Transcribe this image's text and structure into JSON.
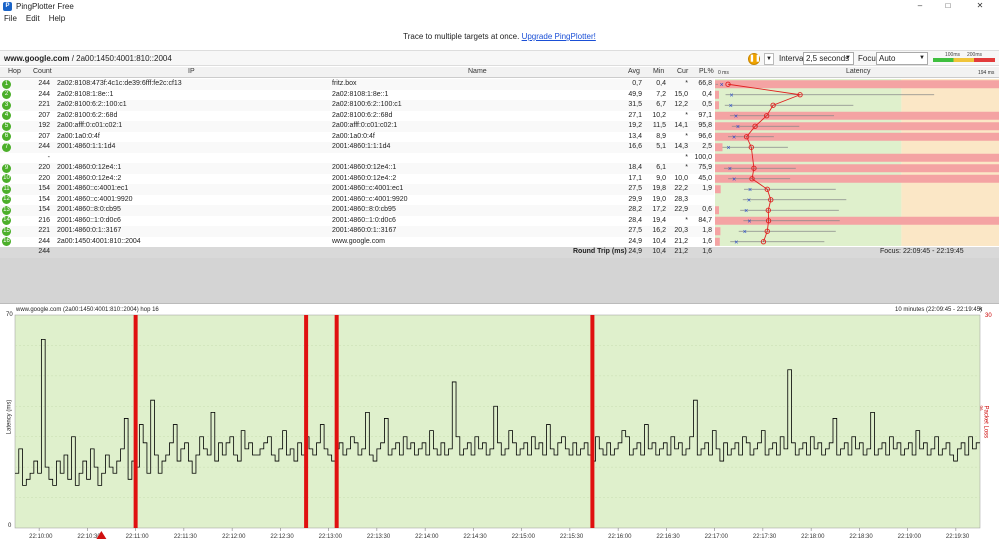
{
  "window": {
    "title": "PingPlotter Free",
    "controls": [
      "–",
      "□",
      "✕"
    ]
  },
  "menu": [
    "File",
    "Edit",
    "Help"
  ],
  "promo": {
    "text": "Trace to multiple targets at once. ",
    "link": "Upgrade PingPlotter!"
  },
  "toolbar": {
    "target_host": "www.google.com",
    "target_ip": " / 2a00:1450:4001:810::2004",
    "interval_label": "Interval",
    "interval_value": "2,5 seconds",
    "focus_label": "Focus",
    "focus_value": "Auto",
    "scale_100": "100ms",
    "scale_200": "200ms"
  },
  "table": {
    "headers": {
      "hop": "Hop",
      "count": "Count",
      "ip": "IP",
      "name": "Name",
      "avg": "Avg",
      "min": "Min",
      "cur": "Cur",
      "pl": "PL%",
      "latency": "Latency",
      "lat_min": "0 ms",
      "lat_max": "194 ms"
    },
    "rows": [
      {
        "hop": "1",
        "count": "244",
        "ip": "2a02:8108:473f:4c1c:de39:6fff:fe2c:cf13",
        "name": "fritz.box",
        "avg": "0,7",
        "min": "0,4",
        "cur": "*",
        "pl": "66,8"
      },
      {
        "hop": "2",
        "count": "244",
        "ip": "2a02:8108:1:8e::1",
        "name": "2a02:8108:1:8e::1",
        "avg": "49,9",
        "min": "7,2",
        "cur": "15,0",
        "pl": "0,4"
      },
      {
        "hop": "3",
        "count": "221",
        "ip": "2a02:8100:6:2::100:c1",
        "name": "2a02:8100:6:2::100:c1",
        "avg": "31,5",
        "min": "6,7",
        "cur": "12,2",
        "pl": "0,5"
      },
      {
        "hop": "4",
        "count": "207",
        "ip": "2a02:8100:6:2::68d",
        "name": "2a02:8100:6:2::68d",
        "avg": "27,1",
        "min": "10,2",
        "cur": "*",
        "pl": "97,1"
      },
      {
        "hop": "5",
        "count": "192",
        "ip": "2a00:afff:0:c01:c02:1",
        "name": "2a00:afff:0:c01:c02:1",
        "avg": "19,2",
        "min": "11,5",
        "cur": "14,1",
        "pl": "95,8"
      },
      {
        "hop": "6",
        "count": "207",
        "ip": "2a00:1a0:0:4f",
        "name": "2a00:1a0:0:4f",
        "avg": "13,4",
        "min": "8,9",
        "cur": "*",
        "pl": "96,6"
      },
      {
        "hop": "7",
        "count": "244",
        "ip": "2001:4860:1:1:1d4",
        "name": "2001:4860:1:1:1d4",
        "avg": "16,6",
        "min": "5,1",
        "cur": "14,3",
        "pl": "2,5"
      },
      {
        "hop": "",
        "count": "-",
        "ip": "",
        "name": "",
        "avg": "",
        "min": "",
        "cur": "*",
        "pl": "100,0"
      },
      {
        "hop": "9",
        "count": "220",
        "ip": "2001:4860:0:12e4::1",
        "name": "2001:4860:0:12e4::1",
        "avg": "18,4",
        "min": "6,1",
        "cur": "*",
        "pl": "75,9"
      },
      {
        "hop": "10",
        "count": "220",
        "ip": "2001:4860:0:12e4::2",
        "name": "2001:4860:0:12e4::2",
        "avg": "17,1",
        "min": "9,0",
        "cur": "10,0",
        "pl": "45,0"
      },
      {
        "hop": "11",
        "count": "154",
        "ip": "2001:4860::c:4001:ec1",
        "name": "2001:4860::c:4001:ec1",
        "avg": "27,5",
        "min": "19,8",
        "cur": "22,2",
        "pl": "1,9"
      },
      {
        "hop": "12",
        "count": "154",
        "ip": "2001:4860::c:4001:9920",
        "name": "2001:4860::c:4001:9920",
        "avg": "29,9",
        "min": "19,0",
        "cur": "28,3",
        "pl": ""
      },
      {
        "hop": "13",
        "count": "154",
        "ip": "2001:4860::8:0:cb95",
        "name": "2001:4860::8:0:cb95",
        "avg": "28,2",
        "min": "17,2",
        "cur": "22,9",
        "pl": "0,6"
      },
      {
        "hop": "14",
        "count": "216",
        "ip": "2001:4860::1:0:d0c6",
        "name": "2001:4860::1:0:d0c6",
        "avg": "28,4",
        "min": "19,4",
        "cur": "*",
        "pl": "84,7"
      },
      {
        "hop": "15",
        "count": "221",
        "ip": "2001:4860:0:1::3167",
        "name": "2001:4860:0:1::3167",
        "avg": "27,5",
        "min": "16,2",
        "cur": "20,3",
        "pl": "1,8"
      },
      {
        "hop": "16",
        "count": "244",
        "ip": "2a00:1450:4001:810::2004",
        "name": "www.google.com",
        "avg": "24,9",
        "min": "10,4",
        "cur": "21,2",
        "pl": "1,6"
      }
    ],
    "summary": {
      "count": "244",
      "label": "Round Trip (ms)",
      "avg": "24,9",
      "min": "10,4",
      "cur": "21,2",
      "pl": "1,6",
      "focus": "Focus: 22:09:45 - 22:19:45"
    }
  },
  "graph": {
    "title": "www.google.com (2a00:1450:4001:810::2004) hop 16",
    "range": "10 minutes (22:09:45 - 22:19:45)",
    "close": "✕",
    "y_max_label": "70",
    "y_zero_label": "0",
    "y_axis_label": "Latency (ms)",
    "pl_axis_label": "Packet Loss %",
    "pl_max_label": "30",
    "x_ticks": [
      "22:10:00",
      "22:10:30",
      "22:11:00",
      "22:11:30",
      "22:12:00",
      "22:12:30",
      "22:13:00",
      "22:13:30",
      "22:14:00",
      "22:14:30",
      "22:15:00",
      "22:15:30",
      "22:16:00",
      "22:16:30",
      "22:17:00",
      "22:17:30",
      "22:18:00",
      "22:18:30",
      "22:19:00",
      "22:19:30"
    ],
    "colors": {
      "green_bg": "#dff0cc",
      "loss": "#e01010",
      "line": "#000000"
    }
  },
  "chart_data": {
    "type": "line",
    "title": "www.google.com (2a00:1450:4001:810::2004) hop 16",
    "xlabel": "",
    "ylabel": "Latency (ms)",
    "ylim": [
      0,
      70
    ],
    "x_range": [
      "22:09:45",
      "22:19:45"
    ],
    "packet_loss_events": [
      "22:11:00",
      "22:12:46",
      "22:13:05",
      "22:15:44"
    ],
    "series": [
      {
        "values": [
          18,
          26,
          14,
          16,
          18,
          22,
          18,
          62,
          20,
          16,
          14,
          22,
          18,
          24,
          16,
          30,
          14,
          18,
          22,
          16,
          26,
          20,
          14,
          18,
          24,
          20,
          18,
          22,
          26,
          36,
          16,
          22,
          20,
          34,
          28,
          18,
          42,
          24,
          18,
          22,
          24,
          28,
          34,
          22,
          26,
          28,
          22,
          18,
          24,
          30,
          26,
          24,
          38,
          22,
          28,
          24,
          28,
          30,
          24,
          22,
          32,
          26,
          28,
          24,
          24,
          26,
          28,
          30,
          24,
          22,
          26,
          32,
          24,
          26,
          22,
          28,
          24,
          30,
          26,
          24,
          28,
          34,
          26,
          24,
          22,
          26,
          28,
          24,
          26,
          30,
          28,
          24,
          26,
          38,
          24,
          22,
          26,
          28,
          36,
          24,
          26,
          28,
          24,
          30,
          26,
          28,
          24,
          26,
          28,
          24,
          32,
          26,
          24,
          28,
          24,
          26,
          48,
          30,
          24,
          26,
          28,
          24,
          30,
          26,
          28,
          24,
          26,
          40,
          28,
          24,
          26,
          32,
          28,
          24,
          26,
          28,
          24,
          30,
          26,
          28,
          24,
          34,
          26,
          24,
          28,
          30,
          26,
          24,
          28,
          24,
          26,
          28,
          24,
          22,
          30,
          26,
          24,
          28,
          24,
          26,
          28,
          32,
          30,
          24,
          26,
          28,
          24,
          34,
          26,
          28,
          24,
          26,
          28,
          24,
          30,
          26,
          28,
          24,
          26,
          30,
          42,
          24,
          26,
          28,
          24,
          32,
          26,
          22,
          28,
          24,
          26,
          28,
          24,
          30,
          28,
          24,
          26,
          28,
          32,
          24,
          26,
          28,
          24,
          30,
          26,
          52,
          28,
          24,
          26,
          28,
          24,
          30,
          26,
          28,
          24,
          26,
          28,
          36,
          24,
          26,
          28,
          24,
          30,
          26,
          28,
          24,
          26,
          38,
          24,
          26,
          28,
          24,
          30,
          26,
          28,
          24,
          26,
          28,
          24,
          32,
          26,
          28,
          24,
          26,
          30,
          24,
          26,
          28,
          24,
          22,
          26,
          28,
          24,
          30,
          26,
          28
        ]
      }
    ]
  }
}
